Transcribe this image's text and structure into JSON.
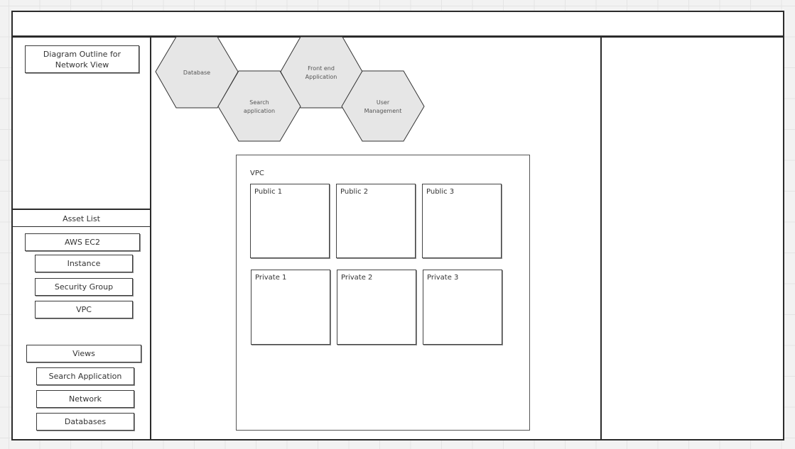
{
  "left_panel": {
    "outline_title": "Diagram Outline for Network View",
    "asset_list": {
      "title": "Asset List",
      "group": "AWS EC2",
      "items": [
        "Instance",
        "Security Group",
        "VPC"
      ]
    },
    "views": {
      "title": "Views",
      "items": [
        "Search Application",
        "Network",
        "Databases"
      ]
    }
  },
  "canvas": {
    "hexagons": [
      {
        "label_lines": [
          "Database"
        ]
      },
      {
        "label_lines": [
          "Search",
          "application"
        ]
      },
      {
        "label_lines": [
          "Front end",
          "Application"
        ]
      },
      {
        "label_lines": [
          "User",
          "Management"
        ]
      }
    ],
    "hexagon_fill": "#e6e6e6",
    "vpc": {
      "label": "VPC",
      "public_subnets": [
        "Public 1",
        "Public 2",
        "Public 3"
      ],
      "private_subnets": [
        "Private 1",
        "Private 2",
        "Private 3"
      ]
    }
  }
}
